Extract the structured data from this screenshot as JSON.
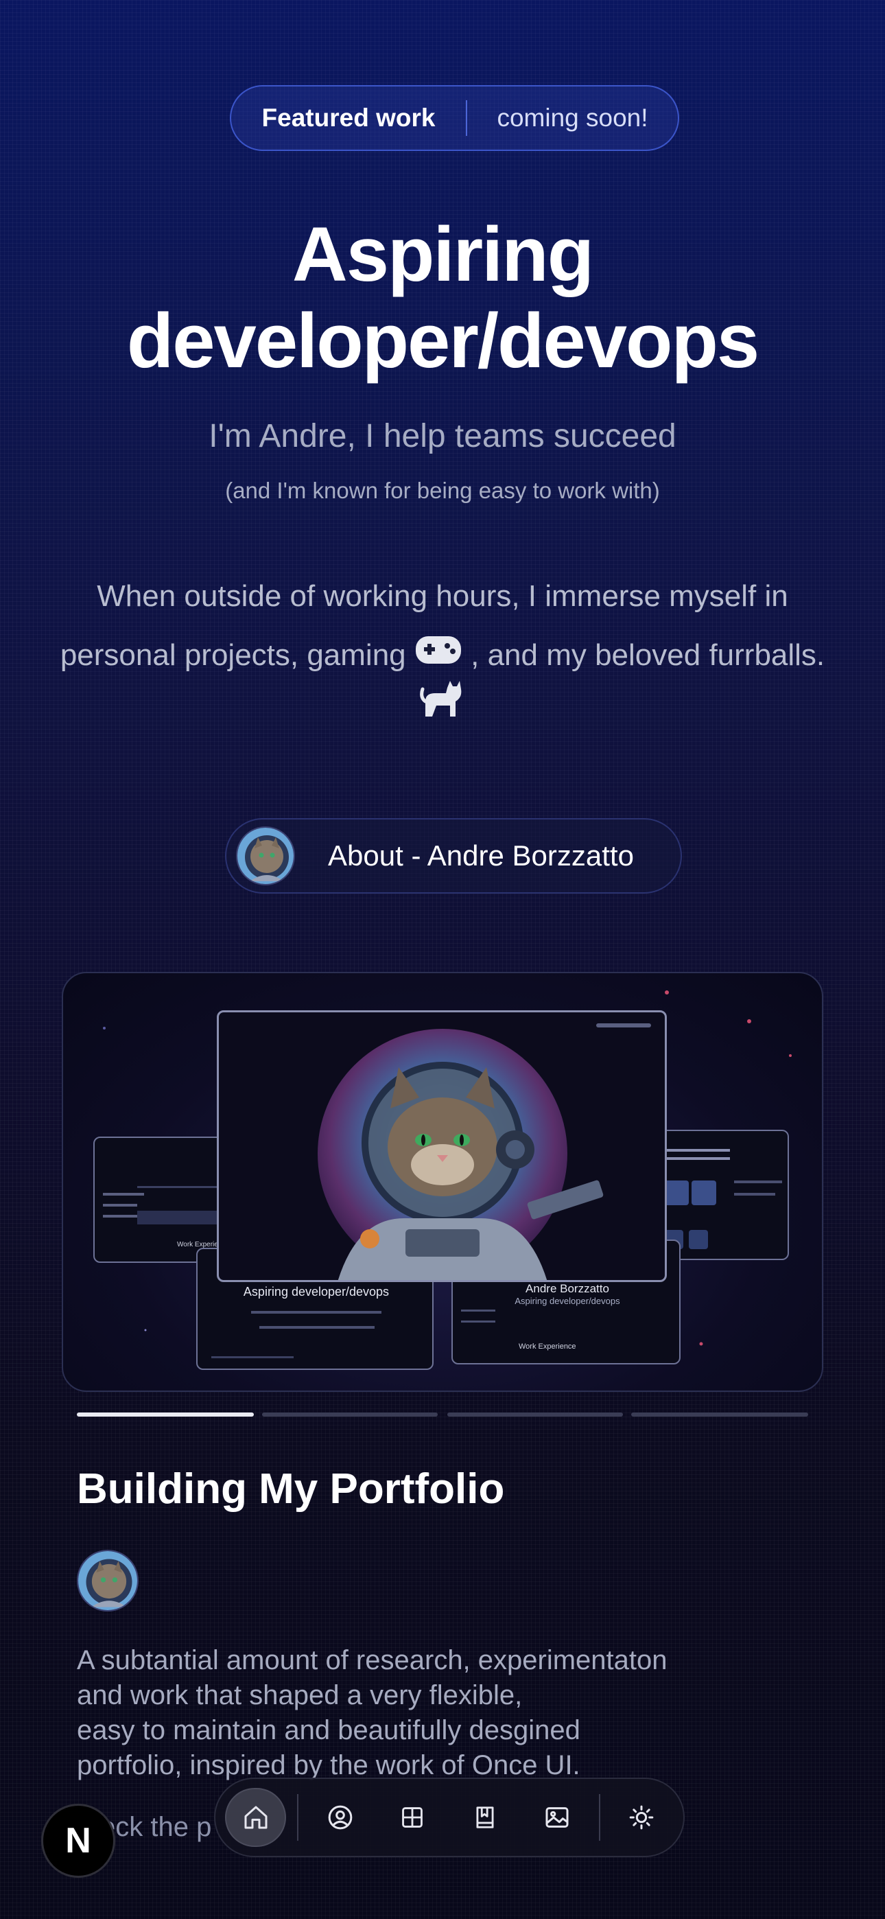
{
  "badge": {
    "featured": "Featured work",
    "soon": "coming soon!"
  },
  "hero": {
    "title_line1": "Aspiring",
    "title_line2": "developer/devops",
    "subtitle": "I'm Andre, I help teams succeed",
    "note": "(and I'm known for being easy to work with)"
  },
  "intro": {
    "line1": "When outside of working hours, I immerse myself in",
    "line2a": "personal projects, gaming",
    "line2b": ", and my beloved furrballs.",
    "icons": [
      "gamepad-icon",
      "cat-icon"
    ]
  },
  "about": {
    "label": "About - Andre Borzzatto"
  },
  "showcase": {
    "slides_total": 4,
    "active_slide": 1,
    "shot_left_title": "Aspiring developer/devops",
    "shot_right_title": "Andre Borzzatto",
    "shot_right_sub": "Aspiring developer/devops",
    "shot_right_section": "Work Experience",
    "shot_left_section": "Work Experience"
  },
  "post": {
    "title": "Building My Portfolio",
    "desc_lines": [
      "A subtantial amount of research, experimentaton",
      "and work that shaped a very flexible,",
      "easy to maintain and beautifully desgined",
      "portfolio, inspired by the work of Once UI."
    ],
    "link_partial": "eck the p"
  },
  "nav": {
    "items": [
      "home-icon",
      "person-icon",
      "grid-icon",
      "book-icon",
      "gallery-icon",
      "theme-toggle-icon"
    ],
    "active": "home-icon"
  },
  "logo": {
    "letter": "N"
  },
  "colors": {
    "accent": "#3b55c9",
    "bg_top": "#0a1660",
    "bg_bottom": "#08081a"
  }
}
